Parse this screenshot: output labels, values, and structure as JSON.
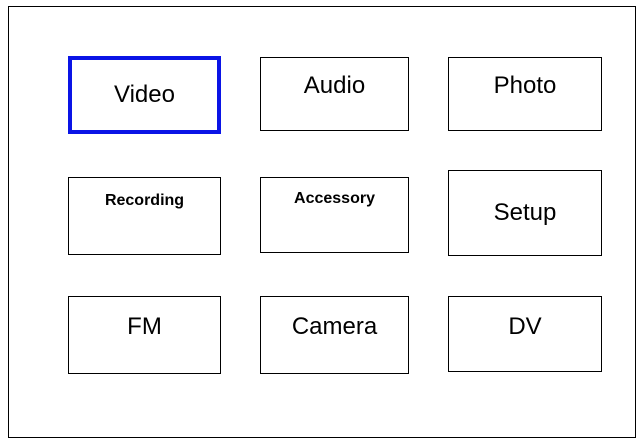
{
  "menu": {
    "selected_color": "#0a14e6",
    "items": [
      {
        "label": "Video",
        "selected": true
      },
      {
        "label": "Audio",
        "selected": false
      },
      {
        "label": "Photo",
        "selected": false
      },
      {
        "label": "Recording",
        "selected": false
      },
      {
        "label": "Accessory",
        "selected": false
      },
      {
        "label": "Setup",
        "selected": false
      },
      {
        "label": "FM",
        "selected": false
      },
      {
        "label": "Camera",
        "selected": false
      },
      {
        "label": "DV",
        "selected": false
      }
    ]
  }
}
